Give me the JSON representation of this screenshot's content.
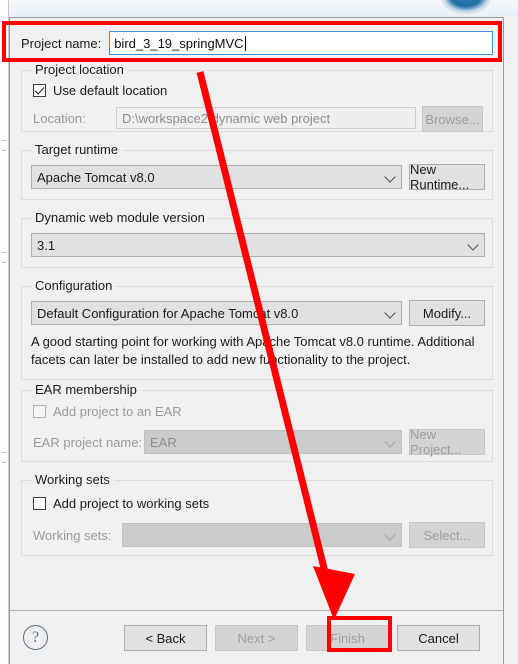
{
  "dialog": {
    "project_name": {
      "label": "Project name:",
      "value": "bird_3_19_springMVC"
    },
    "project_location": {
      "title": "Project location",
      "use_default_label": "Use default location",
      "use_default_checked": true,
      "location_label": "Location:",
      "location_value": "D:\\workspace2\\dynamic web project",
      "browse_button": "Browse..."
    },
    "target_runtime": {
      "title": "Target runtime",
      "selected": "Apache Tomcat v8.0",
      "new_runtime_button": "New Runtime..."
    },
    "module_version": {
      "title": "Dynamic web module version",
      "selected": "3.1"
    },
    "configuration": {
      "title": "Configuration",
      "selected": "Default Configuration for Apache Tomcat v8.0",
      "modify_button": "Modify...",
      "description": "A good starting point for working with Apache Tomcat v8.0 runtime. Additional facets can later be installed to add new functionality to the project."
    },
    "ear_membership": {
      "title": "EAR membership",
      "add_to_ear_label": "Add project to an EAR",
      "add_to_ear_checked": false,
      "ear_project_label": "EAR project name:",
      "ear_project_value": "EAR",
      "new_project_button": "New Project..."
    },
    "working_sets": {
      "title": "Working sets",
      "add_to_working_sets_label": "Add project to working sets",
      "add_to_working_sets_checked": false,
      "working_sets_label": "Working sets:",
      "working_sets_value": "",
      "select_button": "Select..."
    },
    "buttons": {
      "help": "?",
      "back": "< Back",
      "next": "Next >",
      "finish": "Finish",
      "cancel": "Cancel"
    }
  },
  "annotation": {
    "color": "#fe0000",
    "highlight_targets": [
      "project-name-row",
      "finish-button"
    ]
  }
}
